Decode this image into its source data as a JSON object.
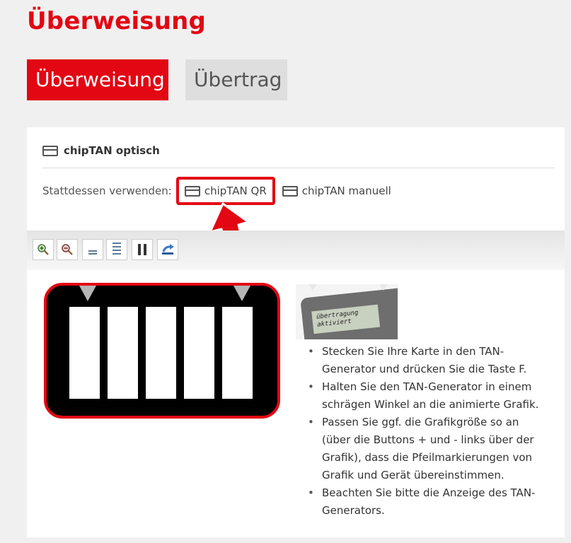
{
  "page_title": "Überweisung",
  "tabs": [
    {
      "label": "Überweisung",
      "active": true
    },
    {
      "label": "Übertrag",
      "active": false
    }
  ],
  "method": {
    "current": "chipTAN optisch",
    "alternatives_label": "Stattdessen verwenden:",
    "alternatives": [
      "chipTAN QR",
      "chipTAN manuell"
    ]
  },
  "toolbar": {
    "buttons": [
      "zoom-in-icon",
      "zoom-out-icon",
      "slower-icon",
      "faster-icon",
      "pause-icon",
      "restart-icon"
    ]
  },
  "device": {
    "screen_line1": "übertragung",
    "screen_line2": "aktiviert"
  },
  "instructions": [
    "Stecken Sie Ihre Karte in den TAN-Generator und drücken Sie die Taste F.",
    "Halten Sie den TAN-Generator in einem schrägen Winkel an die animierte Grafik.",
    "Passen Sie ggf. die Grafikgröße so an (über die Buttons + und - links über der Grafik), dass die Pfeilmarkierungen von Grafik und Gerät übereinstimmen.",
    "Beachten Sie bitte die Anzeige des TAN-Generators."
  ],
  "colors": {
    "brand": "#e30613",
    "background": "#f0f0f0"
  }
}
